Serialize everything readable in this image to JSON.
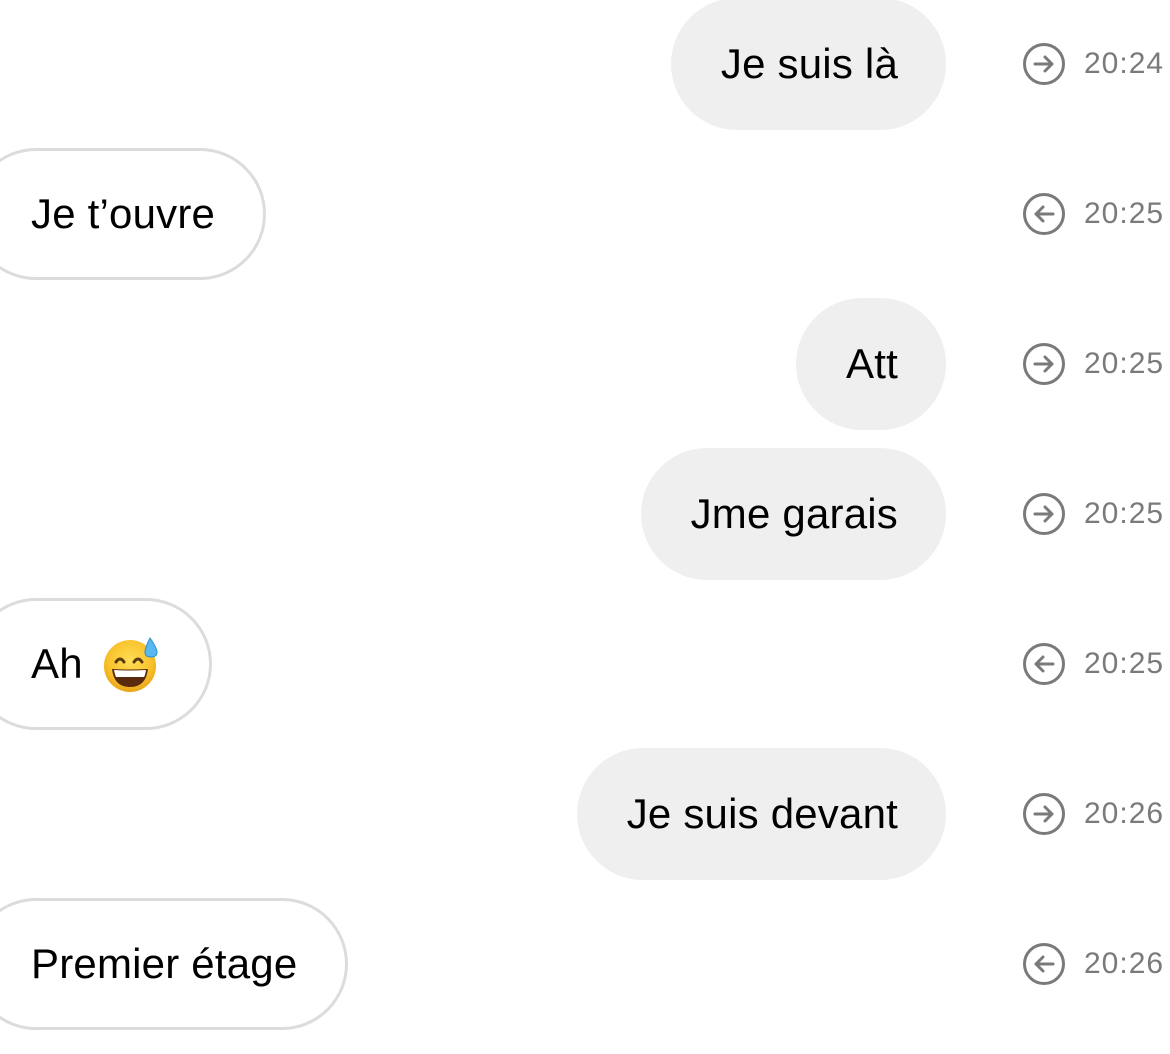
{
  "conversation": {
    "messages": [
      {
        "direction": "sent",
        "text": "Je suis là",
        "time": "20:24",
        "icon": "arrow-right-circle-icon"
      },
      {
        "direction": "received",
        "text": "Je t’ouvre",
        "time": "20:25",
        "icon": "arrow-left-circle-icon"
      },
      {
        "direction": "sent",
        "text": "Att",
        "time": "20:25",
        "icon": "arrow-right-circle-icon"
      },
      {
        "direction": "sent",
        "text": "Jme garais",
        "time": "20:25",
        "icon": "arrow-right-circle-icon"
      },
      {
        "direction": "received",
        "text": "Ah",
        "emoji": "grinning-face-with-sweat-icon",
        "time": "20:25",
        "icon": "arrow-left-circle-icon"
      },
      {
        "direction": "sent",
        "text": "Je suis devant",
        "time": "20:26",
        "icon": "arrow-right-circle-icon"
      },
      {
        "direction": "received",
        "text": "Premier étage",
        "time": "20:26",
        "icon": "arrow-left-circle-icon"
      }
    ]
  },
  "colors": {
    "sent_bubble": "#efefef",
    "received_border": "#dcdcdc",
    "timestamp": "#7a7a7a"
  }
}
